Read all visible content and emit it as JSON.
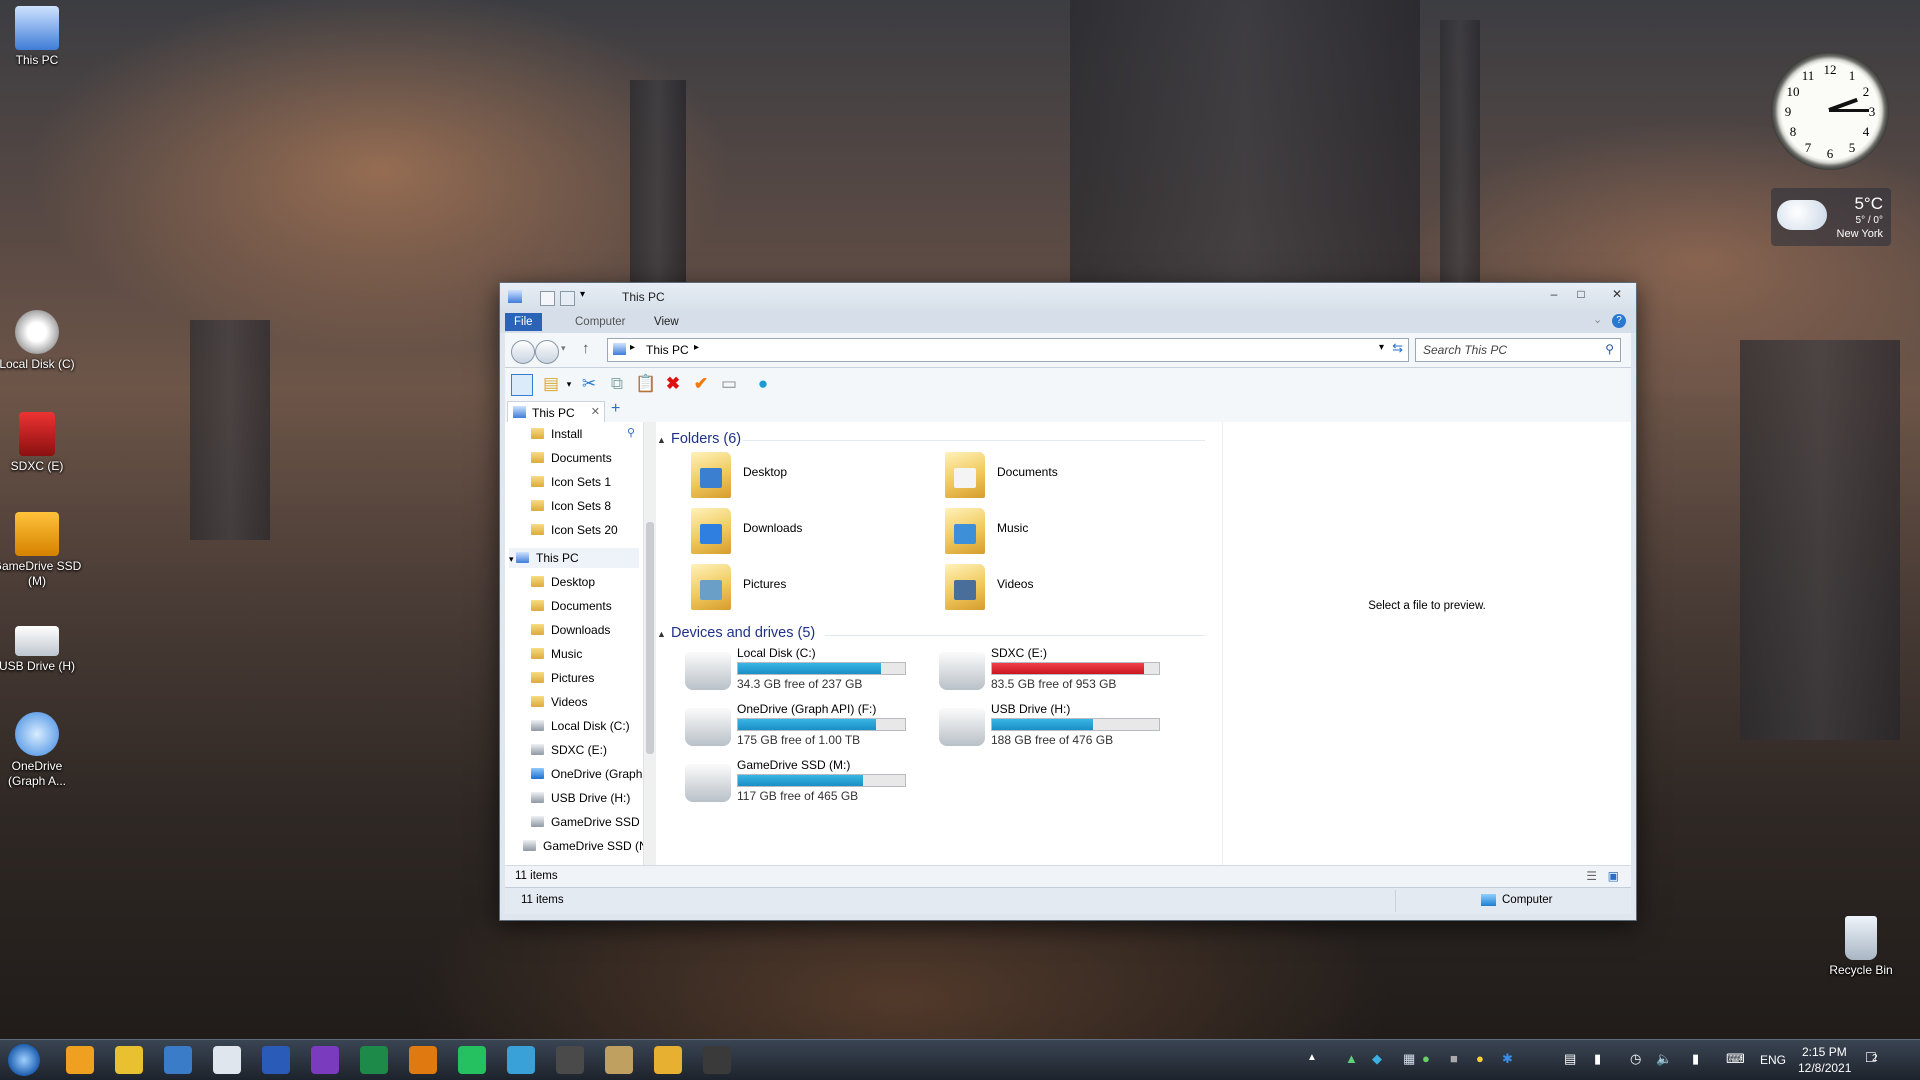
{
  "desktop": {
    "icons": [
      {
        "label": "This PC",
        "icon": "this-pc-icon"
      },
      {
        "label": "Local Disk (C)",
        "icon": "hard-disk-icon"
      },
      {
        "label": "SDXC (E)",
        "icon": "sd-card-icon"
      },
      {
        "label": "GameDrive SSD (M)",
        "icon": "usb-drive-icon"
      },
      {
        "label": "USB Drive (H)",
        "icon": "usb-drive-icon"
      },
      {
        "label": "OneDrive (Graph A...",
        "icon": "onedrive-icon"
      },
      {
        "label": "Recycle Bin",
        "icon": "recycle-bin-icon"
      }
    ]
  },
  "clock_gadget": {
    "numbers": [
      "12",
      "1",
      "2",
      "3",
      "4",
      "5",
      "6",
      "7",
      "8",
      "9",
      "10",
      "11"
    ],
    "time": "2:15"
  },
  "weather_gadget": {
    "temp": "5°C",
    "range": "5° / 0°",
    "city": "New York"
  },
  "window": {
    "title": "This PC",
    "ribbon_tabs": [
      "File",
      "Computer",
      "View"
    ],
    "address": "This PC",
    "search_placeholder": "Search This PC",
    "tab_label": "This PC",
    "nav_items": [
      {
        "label": "Install",
        "indent": 1,
        "type": "folder"
      },
      {
        "label": "Documents",
        "indent": 1,
        "type": "folder"
      },
      {
        "label": "Icon Sets 1",
        "indent": 1,
        "type": "folder"
      },
      {
        "label": "Icon Sets 8",
        "indent": 1,
        "type": "folder"
      },
      {
        "label": "Icon Sets 20",
        "indent": 1,
        "type": "folder"
      },
      {
        "label": "This PC",
        "indent": 0,
        "type": "pc"
      },
      {
        "label": "Desktop",
        "indent": 1,
        "type": "folder"
      },
      {
        "label": "Documents",
        "indent": 1,
        "type": "folder"
      },
      {
        "label": "Downloads",
        "indent": 1,
        "type": "folder"
      },
      {
        "label": "Music",
        "indent": 1,
        "type": "folder"
      },
      {
        "label": "Pictures",
        "indent": 1,
        "type": "folder"
      },
      {
        "label": "Videos",
        "indent": 1,
        "type": "folder"
      },
      {
        "label": "Local Disk (C:)",
        "indent": 1,
        "type": "drive"
      },
      {
        "label": "SDXC (E:)",
        "indent": 1,
        "type": "drive"
      },
      {
        "label": "OneDrive (Graph",
        "indent": 1,
        "type": "cloud"
      },
      {
        "label": "USB Drive (H:)",
        "indent": 1,
        "type": "drive"
      },
      {
        "label": "GameDrive SSD (",
        "indent": 1,
        "type": "drive"
      },
      {
        "label": "GameDrive SSD (N",
        "indent": 0,
        "type": "drive"
      }
    ],
    "folders_header": "Folders (6)",
    "folders": [
      {
        "label": "Desktop",
        "emblem": "#3a7fd0"
      },
      {
        "label": "Documents",
        "emblem": "#f4f4f4"
      },
      {
        "label": "Downloads",
        "emblem": "#2f7fe0"
      },
      {
        "label": "Music",
        "emblem": "#3d8fd8"
      },
      {
        "label": "Pictures",
        "emblem": "#6aa0c8"
      },
      {
        "label": "Videos",
        "emblem": "#4a6e9a"
      }
    ],
    "drives_header": "Devices and drives (5)",
    "drives": [
      {
        "name": "Local Disk (C:)",
        "free": "34.3 GB free of 237 GB",
        "used_fraction": 0.855,
        "color": "blue",
        "icon": "windows-drive-icon"
      },
      {
        "name": "SDXC (E:)",
        "free": "83.5 GB free of 953 GB",
        "used_fraction": 0.912,
        "color": "red",
        "icon": "locked-drive-icon"
      },
      {
        "name": "OneDrive (Graph API) (F:)",
        "free": "175 GB free of 1.00 TB",
        "used_fraction": 0.829,
        "color": "blue",
        "icon": "onedrive-drive-icon"
      },
      {
        "name": "USB Drive (H:)",
        "free": "188 GB free of 476 GB",
        "used_fraction": 0.605,
        "color": "blue",
        "icon": "usb-drive-icon"
      },
      {
        "name": "GameDrive SSD (M:)",
        "free": "117 GB free of 465 GB",
        "used_fraction": 0.748,
        "color": "blue",
        "icon": "locked-drive-icon"
      }
    ],
    "preview_message": "Select a file to preview.",
    "status_items": "11 items",
    "status_items_bottom": "11 items",
    "status_location": "Computer"
  },
  "taskbar": {
    "time": "2:15 PM",
    "date": "12/8/2021",
    "language": "ENG",
    "notification_count": "2",
    "apps": [
      "start-orb-icon",
      "search-icon",
      "chrome-icon",
      "bug-icon",
      "circle-app-icon",
      "word-icon",
      "onenote-icon",
      "excel-icon",
      "outlook-icon",
      "whatsapp-icon",
      "photos-icon",
      "media-icon",
      "library-icon",
      "file-explorer-icon",
      "terminal-icon"
    ]
  }
}
